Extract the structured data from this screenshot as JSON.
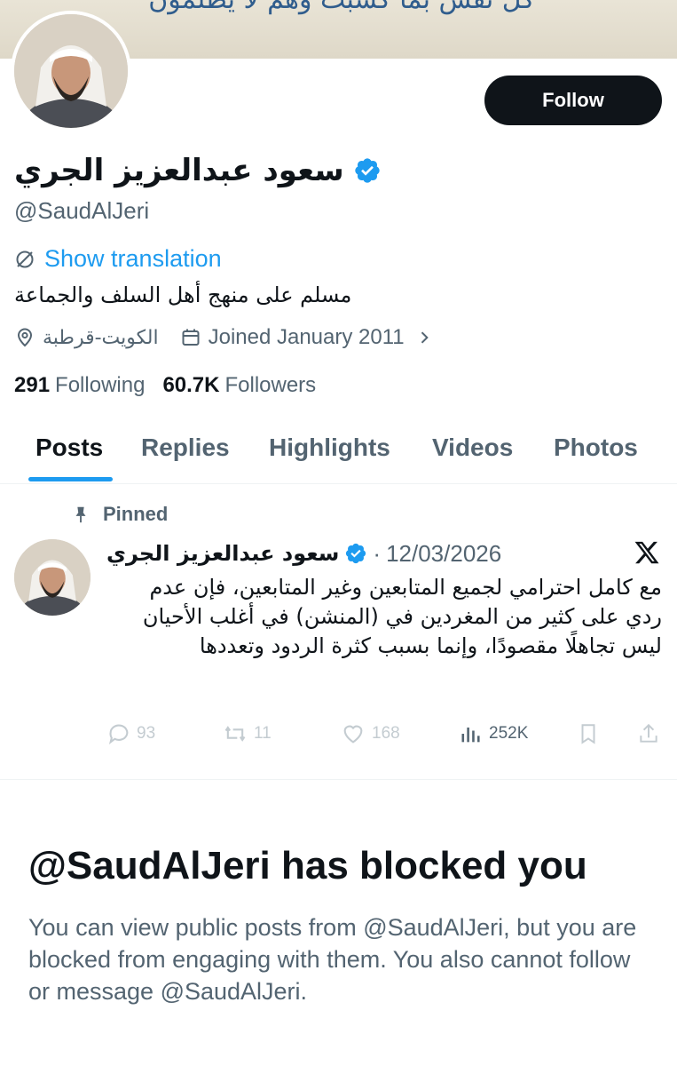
{
  "banner": {
    "text": "كل نفس بما كسبت وهم لا يظلمون"
  },
  "profile": {
    "display_name": "سعود عبدالعزيز الجري",
    "handle": "@SaudAlJeri",
    "follow_label": "Follow",
    "show_translation": "Show translation",
    "bio": "مسلم على منهج أهل السلف والجماعة",
    "location": "الكويت-قرطبة",
    "joined": "Joined January 2011",
    "following_count": "291",
    "following_label": "Following",
    "followers_count": "60.7K",
    "followers_label": "Followers"
  },
  "tabs": [
    {
      "label": "Posts",
      "active": true
    },
    {
      "label": "Replies",
      "active": false
    },
    {
      "label": "Highlights",
      "active": false
    },
    {
      "label": "Videos",
      "active": false
    },
    {
      "label": "Photos",
      "active": false
    }
  ],
  "pinned_post": {
    "pinned_label": "Pinned",
    "author": "سعود عبدالعزيز الجري",
    "separator": "·",
    "date": "12/03/2026",
    "text": "مع كامل احترامي لجميع المتابعين وغير المتابعين، فإن عدم ردي على كثير من المغردين في (المنشن) في أغلب الأحيان ليس تجاهلًا مقصودًا، وإنما بسبب كثرة الردود وتعددها",
    "replies": "93",
    "reposts": "11",
    "likes": "168",
    "views": "252K"
  },
  "blocked": {
    "title": "@SaudAlJeri has blocked you",
    "description": "You can view public posts from @SaudAlJeri, but you are blocked from engaging with them. You also cannot follow or message @SaudAlJeri."
  },
  "colors": {
    "accent": "#1d9bf0",
    "text_primary": "#0f1419",
    "text_secondary": "#536471",
    "muted_action": "#c4ccd1",
    "follow_bg": "#0f1419"
  },
  "icons": [
    "verified-badge-icon",
    "translate-icon",
    "location-icon",
    "calendar-icon",
    "chevron-right-icon",
    "pin-icon",
    "x-logo-icon",
    "reply-icon",
    "repost-icon",
    "like-icon",
    "views-icon",
    "bookmark-icon",
    "share-icon"
  ]
}
